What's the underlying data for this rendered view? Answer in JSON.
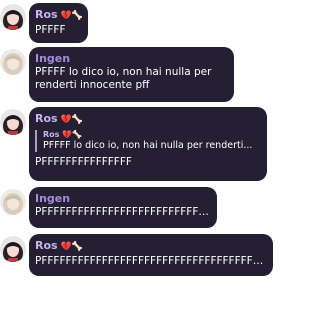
{
  "colors": {
    "bubble_bg": "#241f33",
    "name_ros": "#c9b3ee",
    "name_ingen": "#a68cd8",
    "text": "#ffffff"
  },
  "messages": [
    {
      "sender": "Ros",
      "sender_emoji": "💔🦴",
      "avatar": "dark-haired-avatar",
      "text": "PFFFF"
    },
    {
      "sender": "Ingen",
      "sender_emoji": "",
      "avatar": "light-haired-avatar",
      "text": "PFFFF lo dico io, non hai nulla per\nrenderti innocente pff"
    },
    {
      "sender": "Ros",
      "sender_emoji": "💔🦴",
      "avatar": "dark-haired-avatar",
      "reply": {
        "sender": "Ros",
        "sender_emoji": "💔🦴",
        "text": "PFFFF lo dico io, non hai nulla per renderti..."
      },
      "text": "PFFFFFFFFFFFFFFF"
    },
    {
      "sender": "Ingen",
      "sender_emoji": "",
      "avatar": "light-haired-avatar",
      "text": "PFFFFFFFFFFFFFFFFFFFFFFFFFFFF"
    },
    {
      "sender": "Ros",
      "sender_emoji": "💔🦴",
      "avatar": "dark-haired-avatar",
      "text": "PFFFFFFFFFFFFFFFFFFFFFFFFFFFFFFFFFFFF..."
    }
  ]
}
